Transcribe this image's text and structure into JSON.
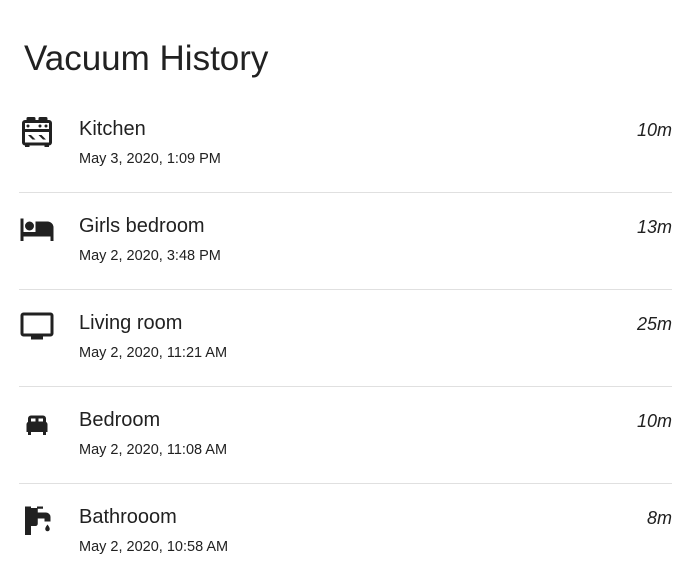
{
  "card": {
    "title": "Vacuum History"
  },
  "entries": [
    {
      "room": "Kitchen",
      "timestamp": "May 3, 2020, 1:09 PM",
      "duration": "10m",
      "icon": "stove-icon"
    },
    {
      "room": "Girls bedroom",
      "timestamp": "May 2, 2020, 3:48 PM",
      "duration": "13m",
      "icon": "bed-icon"
    },
    {
      "room": "Living room",
      "timestamp": "May 2, 2020, 11:21 AM",
      "duration": "25m",
      "icon": "television-icon"
    },
    {
      "room": "Bedroom",
      "timestamp": "May 2, 2020, 11:08 AM",
      "duration": "10m",
      "icon": "bed-empty-icon"
    },
    {
      "room": "Bathrooom",
      "timestamp": "May 2, 2020, 10:58 AM",
      "duration": "8m",
      "icon": "faucet-icon"
    }
  ],
  "colors": {
    "text": "#212121",
    "divider": "#e0e0e0",
    "background": "#ffffff"
  }
}
